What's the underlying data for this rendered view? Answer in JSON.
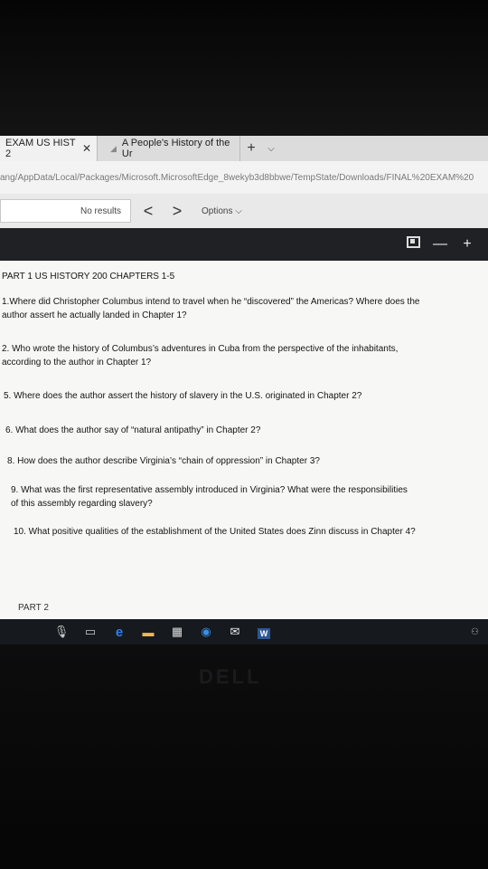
{
  "browser": {
    "tabs": [
      {
        "label": "EXAM US HIST 2",
        "active": true
      },
      {
        "label": "A People's History of the Ur",
        "active": false
      }
    ],
    "new_tab": "+",
    "tab_menu": "⌵",
    "address": "ang/AppData/Local/Packages/Microsoft.MicrosoftEdge_8wekyb3d8bbwe/TempState/Downloads/FINAL%20EXAM%20"
  },
  "findbar": {
    "status": "No results",
    "prev": "<",
    "next": ">",
    "options": "Options"
  },
  "pdf_toolbar": {
    "minus": "—",
    "plus": "+"
  },
  "document": {
    "heading": "PART 1 US HISTORY 200 CHAPTERS 1-5",
    "questions": [
      "1.Where did Christopher Columbus intend to travel when he “discovered” the Americas? Where does the author assert he actually landed in Chapter 1?",
      "2. Who wrote the history of Columbus’s adventures in Cuba from the perspective of the inhabitants, according to the author in Chapter 1?",
      "5. Where does the author assert the history of slavery in the U.S. originated in Chapter 2?",
      "6. What does the author say of “natural antipathy” in Chapter 2?",
      "8. How does the author describe Virginia’s “chain of oppression” in Chapter 3?",
      "9. What was the first representative assembly introduced in Virginia? What were the responsibilities of this assembly regarding slavery?",
      "10. What positive qualities of the establishment of the United States does Zinn discuss in Chapter 4?"
    ],
    "part2": "PART 2"
  },
  "taskbar": {
    "word_label": "W"
  },
  "bezel": {
    "logo": "DELL"
  }
}
